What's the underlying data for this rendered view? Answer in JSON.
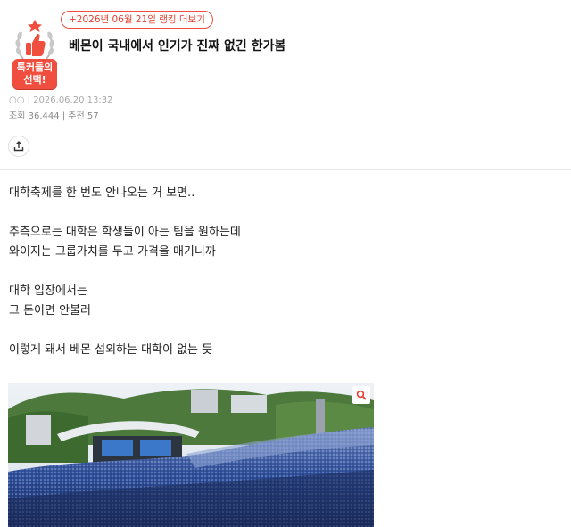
{
  "badge": {
    "label_line1": "톡커들의",
    "label_line2": "선택!"
  },
  "ranking_link": "+2026년 06월 21일 랭킹 더보기",
  "post": {
    "title": "베몬이 국내에서 인기가 진짜 없긴 한가봄",
    "author": "○○",
    "datetime": "| 2026.06.20 13:32",
    "views": "조회 36,444 | 추천 57"
  },
  "body_lines": [
    "대학축제를 한 번도 안나오는 거 보면..",
    "",
    "추측으로는 대학은 학생들이 아는 팀을 원하는데",
    "와이지는 그룹가치를 두고 가격을 매기니까",
    "",
    "대학 입장에서는",
    "그 돈이면 안불러",
    "",
    "이렇게 돼서 베몬 섭외하는 대학이 없는 듯"
  ],
  "icons": {
    "share": "share-icon",
    "zoom": "search-icon",
    "badge_emblem": "thumbs-up-laurel-icon"
  },
  "colors": {
    "accent": "#f04e3e",
    "crowd": "#2e4f9c"
  }
}
